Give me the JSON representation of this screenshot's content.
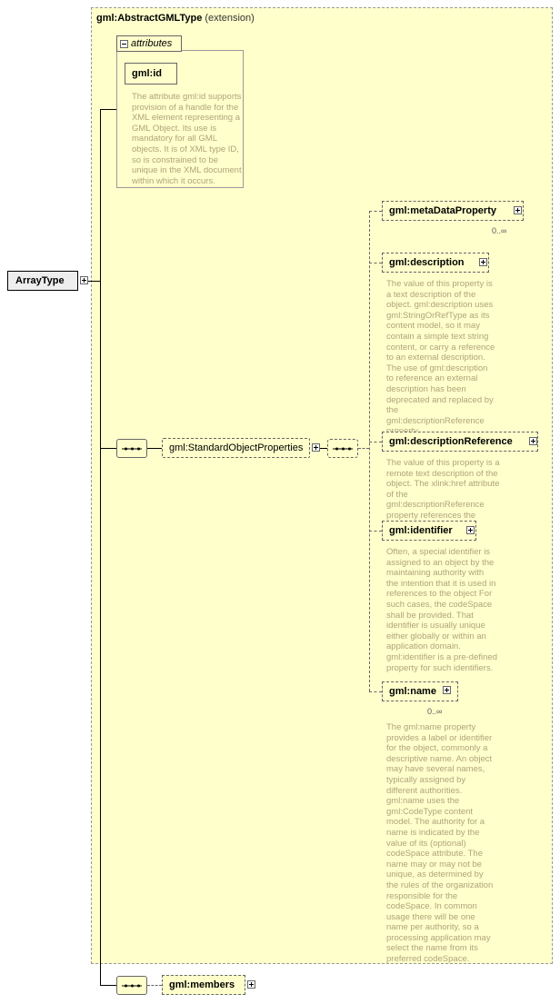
{
  "diagram": {
    "type": "xsd-schema-tree",
    "root": {
      "label": "ArrayType"
    },
    "extension_panel": {
      "title_main": "gml:AbstractGMLType",
      "title_suffix": "(extension)"
    },
    "attributes_group": {
      "header_label": "attributes",
      "attribute": {
        "label": "gml:id"
      },
      "documentation": "The attribute gml:id supports provision of a handle for the XML element representing a GML Object. Its use is mandatory for all GML objects. It is of XML type ID, so is constrained to be unique in the XML document within which it occurs."
    },
    "group_node": {
      "label": "gml:StandardObjectProperties"
    },
    "elements": [
      {
        "label": "gml:metaDataProperty",
        "occurs": "0..∞",
        "documentation": ""
      },
      {
        "label": "gml:description",
        "occurs": "",
        "documentation": "The value of this property is a text description of the object. gml:description uses gml:StringOrRefType as its content model, so it may contain a simple text string content, or carry a reference to an external description. The use of gml:description to reference an external description has been deprecated and replaced by the gml:descriptionReference property."
      },
      {
        "label": "gml:descriptionReference",
        "occurs": "",
        "documentation": "The value of this property is a remote text description of the object. The xlink:href attribute of the gml:descriptionReference property references the external description."
      },
      {
        "label": "gml:identifier",
        "occurs": "",
        "documentation": "Often, a special identifier is assigned to an object by the maintaining authority with the intention that it is used in references to the object For such cases, the codeSpace shall be provided. That identifier is usually unique either globally or within an application domain. gml:identifier is a pre-defined property for such identifiers."
      },
      {
        "label": "gml:name",
        "occurs": "0..∞",
        "documentation": "The gml:name property provides a label or identifier for the object, commonly a descriptive name. An object may have several names, typically assigned by different authorities. gml:name uses the gml:CodeType content model. The authority for a name is indicated by the value of its (optional) codeSpace attribute.  The name may or may not be unique, as determined by the rules of the organization responsible for the codeSpace.  In common usage there will be one name per authority, so a processing application may select the name from its preferred codeSpace."
      }
    ],
    "members_element": {
      "label": "gml:members"
    }
  }
}
